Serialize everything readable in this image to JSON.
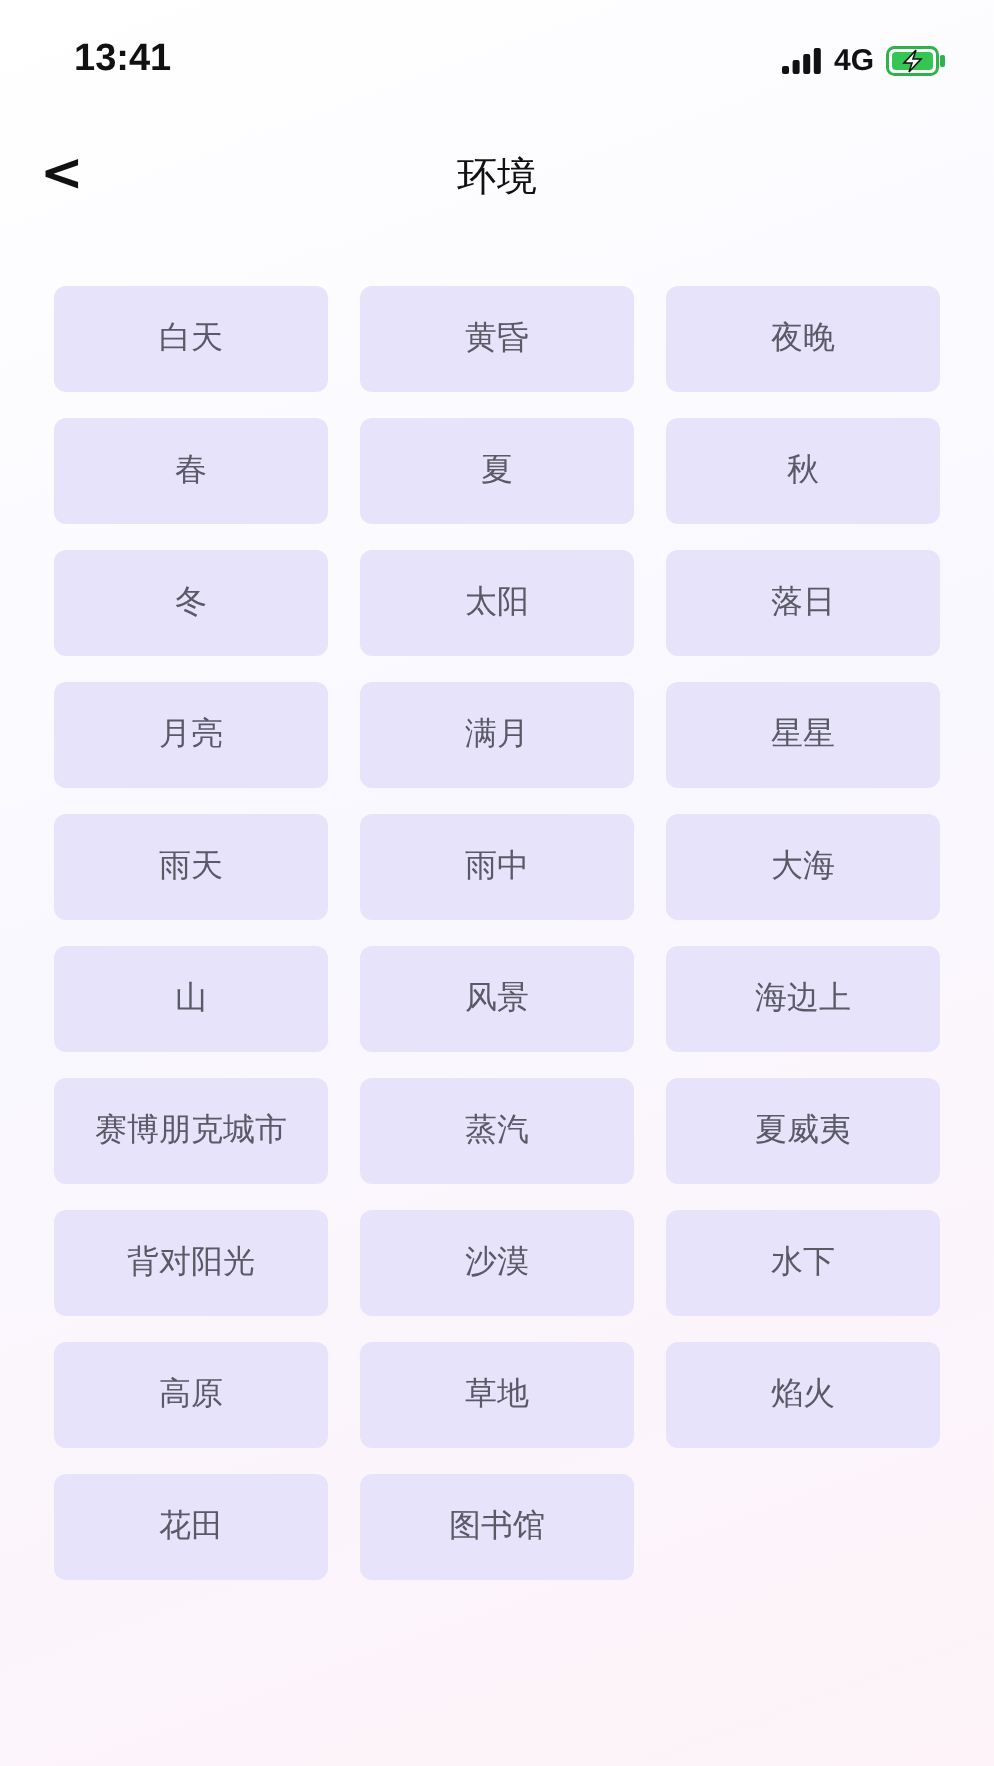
{
  "status_bar": {
    "time": "13:41",
    "network": "4G"
  },
  "header": {
    "back": "<",
    "title": "环境"
  },
  "options": [
    "白天",
    "黄昏",
    "夜晚",
    "春",
    "夏",
    "秋",
    "冬",
    "太阳",
    "落日",
    "月亮",
    "满月",
    "星星",
    "雨天",
    "雨中",
    "大海",
    "山",
    "风景",
    "海边上",
    "赛博朋克城市",
    "蒸汽",
    "夏威夷",
    "背对阳光",
    "沙漠",
    "水下",
    "高原",
    "草地",
    "焰火",
    "花田",
    "图书馆"
  ]
}
